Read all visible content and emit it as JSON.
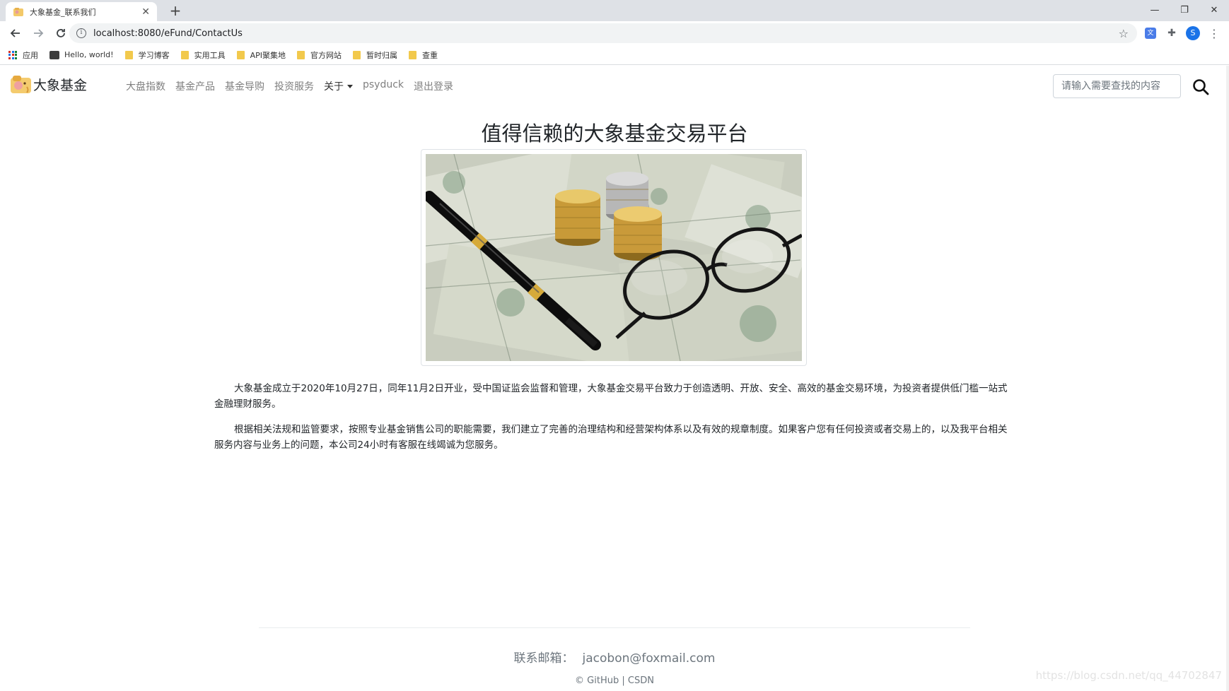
{
  "browser": {
    "tab_title": "大象基金_联系我们",
    "new_tab": "+",
    "url": "localhost:8080/eFund/ContactUs",
    "profile_initial": "S",
    "window_controls": [
      "minimize-icon",
      "restore-icon",
      "close-icon"
    ]
  },
  "bookmarks": {
    "apps_label": "应用",
    "items": [
      "Hello, world!",
      "学习博客",
      "实用工具",
      "API聚集地",
      "官方网站",
      "暂时归属",
      "查重"
    ]
  },
  "navbar": {
    "brand": "大象基金",
    "links": [
      "大盘指数",
      "基金产品",
      "基金导购",
      "投资服务"
    ],
    "dropdown_label": "关于",
    "user": "psyduck",
    "logout": "退出登录",
    "search_placeholder": "请输入需要查找的内容"
  },
  "main": {
    "headline": "值得信赖的大象基金交易平台",
    "paragraphs": [
      "大象基金成立于2020年10月27日，同年11月2日开业，受中国证监会监督和管理，大象基金交易平台致力于创造透明、开放、安全、高效的基金交易环境，为投资者提供低门槛一站式金融理财服务。",
      "根据相关法规和监管要求，按照专业基金销售公司的职能需要，我们建立了完善的治理结构和经营架构体系以及有效的规章制度。如果客户您有任何投资或者交易上的，以及我平台相关服务内容与业务上的问题，本公司24小时有客服在线竭诚为您服务。"
    ]
  },
  "footer": {
    "contact_label": "联系邮箱：",
    "email": "jacobon@foxmail.com",
    "copyright_symbol": "©",
    "github": "GitHub",
    "separator": "|",
    "csdn": "CSDN",
    "watermark": "https://blog.csdn.net/qq_44702847"
  },
  "colors": {
    "nav_link": "#7f7f7f",
    "text": "#212529",
    "muted": "#6c757d",
    "tabstrip": "#dee1e6"
  }
}
